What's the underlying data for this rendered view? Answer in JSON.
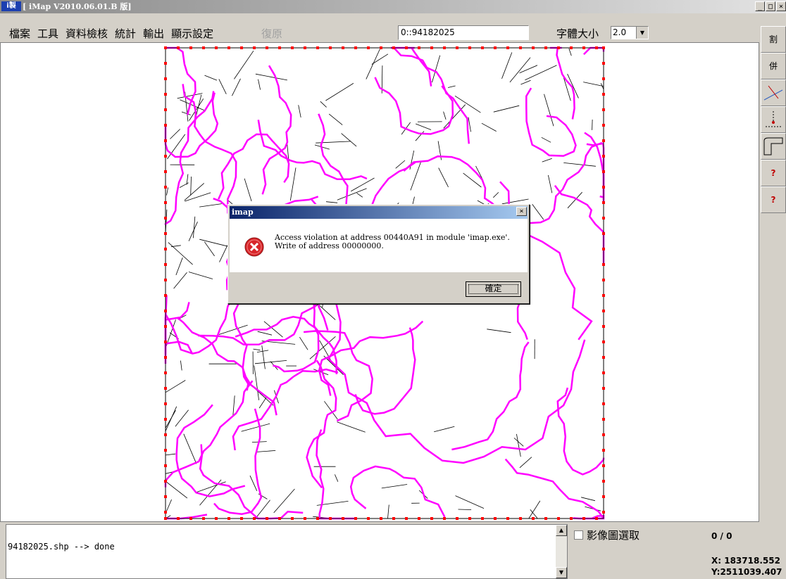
{
  "window": {
    "title": "[ iMap V2010.06.01.B 版]",
    "app_icon_label": "i製",
    "controls": [
      "_",
      "□",
      "×"
    ]
  },
  "menu": {
    "items": [
      "檔案",
      "工具",
      "資料檢核",
      "統計",
      "輸出",
      "顯示設定"
    ],
    "disabled_item": "復原"
  },
  "coord_field": {
    "value": "0::94182025"
  },
  "font_size": {
    "label": "字體大小",
    "value": "2.0",
    "arrow": "▼"
  },
  "toolbar": {
    "tools": [
      {
        "label": "割",
        "icon": "split-icon"
      },
      {
        "label": "併",
        "icon": "merge-icon"
      },
      {
        "label": "",
        "icon": "line-node-icon"
      },
      {
        "label": "",
        "icon": "point-node-icon"
      },
      {
        "label": "",
        "icon": "polygon-icon"
      },
      {
        "label": "?",
        "icon": "query-icon"
      },
      {
        "label": "?",
        "icon": "line-query-icon"
      }
    ]
  },
  "dialog": {
    "title": "imap",
    "close": "×",
    "message": "Access violation at address 00440A91 in module 'imap.exe'. Write of address 00000000.",
    "ok_label": "確定"
  },
  "log": {
    "text": "94182025.shp --> done",
    "up": "▲",
    "down": "▼"
  },
  "image_select": {
    "label": "影像圖選取"
  },
  "status": {
    "count": "0 / 0",
    "x": "X: 183718.552",
    "y": "Y:2511039.407"
  },
  "colors": {
    "map_lines": "#ff00ff",
    "parcel_lines": "#000000",
    "frame_markers": "#ff0000",
    "dialog_title": "#0a246a"
  }
}
